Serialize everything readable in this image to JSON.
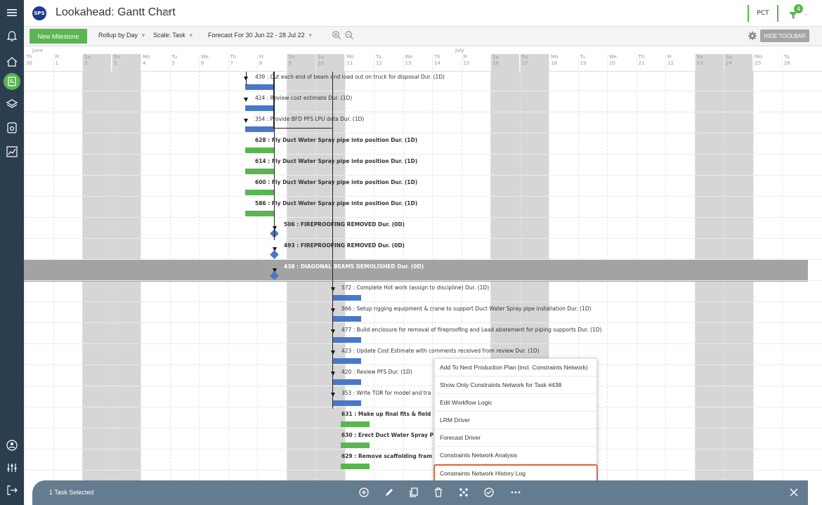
{
  "header": {
    "logo": "SPS",
    "title": "Lookahead: Gantt Chart",
    "pct_label": "PCT",
    "filter_count": "4"
  },
  "toolbar": {
    "new_milestone": "New Milestone",
    "rollup": "Rollup by Day",
    "scale": "Scale: Task",
    "forecast": "Forecast For 30 Jun 22 - 28 Jul 22",
    "hide_toolbar": "HIDE TOOLBAR"
  },
  "timeline": {
    "months": [
      "June",
      "July"
    ],
    "days": [
      {
        "dow": "Th",
        "num": "30"
      },
      {
        "dow": "Fr",
        "num": "1"
      },
      {
        "dow": "Sa",
        "num": "2"
      },
      {
        "dow": "Su",
        "num": "3"
      },
      {
        "dow": "Mo",
        "num": "4"
      },
      {
        "dow": "Tu",
        "num": "5"
      },
      {
        "dow": "We",
        "num": "6"
      },
      {
        "dow": "Th",
        "num": "7"
      },
      {
        "dow": "Fr",
        "num": "8"
      },
      {
        "dow": "Sa",
        "num": "9"
      },
      {
        "dow": "Su",
        "num": "10"
      },
      {
        "dow": "Mo",
        "num": "11"
      },
      {
        "dow": "Tu",
        "num": "12"
      },
      {
        "dow": "We",
        "num": "13"
      },
      {
        "dow": "Th",
        "num": "14"
      },
      {
        "dow": "Fr",
        "num": "15"
      },
      {
        "dow": "Sa",
        "num": "16"
      },
      {
        "dow": "Su",
        "num": "17"
      },
      {
        "dow": "Mo",
        "num": "18"
      },
      {
        "dow": "Tu",
        "num": "19"
      },
      {
        "dow": "We",
        "num": "20"
      },
      {
        "dow": "Th",
        "num": "21"
      },
      {
        "dow": "Fr",
        "num": "22"
      },
      {
        "dow": "Sa",
        "num": "23"
      },
      {
        "dow": "Su",
        "num": "24"
      },
      {
        "dow": "Mo",
        "num": "25"
      },
      {
        "dow": "Tu",
        "num": "26"
      }
    ]
  },
  "tasks": [
    {
      "label": "439 : Cut each end of beam and load out on truck for disposal Dur. (1D)",
      "kind": "blue",
      "bold": false
    },
    {
      "label": "424 : Review cost estimate Dur. (1D)",
      "kind": "blue",
      "bold": false
    },
    {
      "label": "354 : Provide BFD PFS LPU data Dur. (1D)",
      "kind": "blue",
      "bold": false
    },
    {
      "label": "628 : Fly Duct Water Spray pipe into position Dur. (1D)",
      "kind": "green",
      "bold": true
    },
    {
      "label": "614 : Fly Duct Water Spray pipe into position Dur. (1D)",
      "kind": "green",
      "bold": true
    },
    {
      "label": "600 : Fly Duct Water Spray pipe into position Dur. (1D)",
      "kind": "green",
      "bold": true
    },
    {
      "label": "586 : Fly Duct Water Spray pipe into position Dur. (1D)",
      "kind": "green",
      "bold": true
    },
    {
      "label": "506 : FIREPROOFING REMOVED Dur. (0D)",
      "kind": "milestone",
      "bold": true
    },
    {
      "label": "493 : FIREPROOFING REMOVED Dur. (0D)",
      "kind": "milestone",
      "bold": true
    },
    {
      "label": "438 : DIAGONAL BEAMS DEMOLISHED Dur. (0D)",
      "kind": "milestone",
      "bold": true,
      "selected": true
    },
    {
      "label": "572 : Complete Hot work (assign to discipline) Dur. (1D)",
      "kind": "blue",
      "bold": false
    },
    {
      "label": "566 : Setup rigging equipment & crane to support Duct Water Spray pipe installation Dur. (1D)",
      "kind": "blue",
      "bold": false
    },
    {
      "label": "477 : Build enclosure for removal of fireproofing and Lead abatement for piping supports Dur. (1D)",
      "kind": "blue",
      "bold": false
    },
    {
      "label": "423 : Update Cost Estimate with comments received from review Dur. (1D)",
      "kind": "blue",
      "bold": false
    },
    {
      "label": "420 : Review PFS Dur. (1D)",
      "kind": "blue",
      "bold": false
    },
    {
      "label": "353 : Write TOR for model and tra",
      "kind": "blue",
      "bold": false
    },
    {
      "label": "631 : Make up final fits & field",
      "kind": "green",
      "bold": true
    },
    {
      "label": "630 : Erect Duct Water Spray P",
      "kind": "green",
      "bold": true
    },
    {
      "label": "629 : Remove scaffolding fram",
      "kind": "green",
      "bold": true
    }
  ],
  "context_menu": {
    "items": [
      "Add To Next Production Plan (incl. Constraints Network)",
      "Show Only Constraints Network for Task #438",
      "Edit Workflow Logic",
      "LRM Driver",
      "Forecast Driver",
      "Constraints Network Analysis",
      "Constraints Network History Log"
    ]
  },
  "bottom_bar": {
    "selected_text": "1 Task Selected"
  },
  "colors": {
    "sidebar": "#2b3e4f",
    "accent_green": "#5ab552",
    "bar_blue": "#4a78c8",
    "highlight_orange": "#e0683a",
    "bottom_bar": "#647c90"
  }
}
